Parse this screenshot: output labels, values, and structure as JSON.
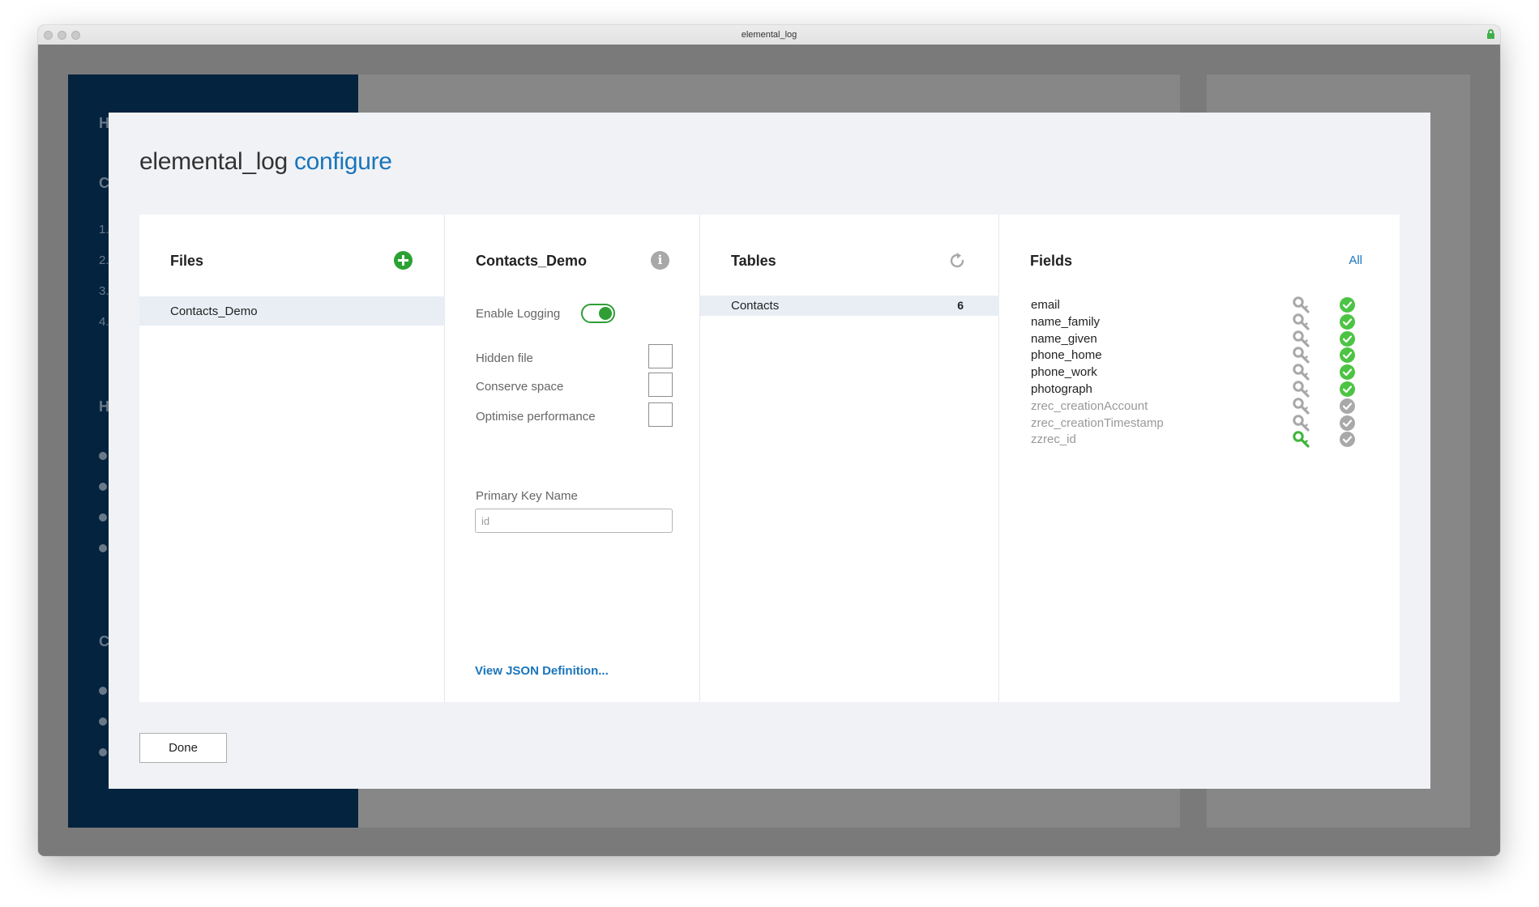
{
  "window": {
    "title": "elemental_log"
  },
  "background": {
    "sidebar_letters": [
      "H",
      "C",
      "H",
      "C"
    ],
    "sidebar_numbers": [
      "1.",
      "2.",
      "3.",
      "4."
    ]
  },
  "modal": {
    "title_app": "elemental_log",
    "title_action": "configure",
    "done_label": "Done"
  },
  "files": {
    "heading": "Files",
    "add_icon": "plus-circle-icon",
    "items": [
      "Contacts_Demo"
    ]
  },
  "file_settings": {
    "heading": "Contacts_Demo",
    "info_icon": "info-icon",
    "enable_logging_label": "Enable Logging",
    "enable_logging": true,
    "hidden_file_label": "Hidden file",
    "conserve_space_label": "Conserve space",
    "optimise_label": "Optimise performance",
    "primary_key_label": "Primary Key Name",
    "primary_key_value": "id",
    "json_link": "View JSON Definition..."
  },
  "tables": {
    "heading": "Tables",
    "refresh_icon": "refresh-icon",
    "items": [
      {
        "name": "Contacts",
        "count": "6"
      }
    ]
  },
  "fields": {
    "heading": "Fields",
    "all_link": "All",
    "items": [
      {
        "name": "email",
        "system": false,
        "primary_key": false
      },
      {
        "name": "name_family",
        "system": false,
        "primary_key": false
      },
      {
        "name": "name_given",
        "system": false,
        "primary_key": false
      },
      {
        "name": "phone_home",
        "system": false,
        "primary_key": false
      },
      {
        "name": "phone_work",
        "system": false,
        "primary_key": false
      },
      {
        "name": "photograph",
        "system": false,
        "primary_key": false
      },
      {
        "name": "zrec_creationAccount",
        "system": true,
        "primary_key": false
      },
      {
        "name": "zrec_creationTimestamp",
        "system": true,
        "primary_key": false
      },
      {
        "name": "zzrec_id",
        "system": true,
        "primary_key": true
      }
    ]
  },
  "colors": {
    "accent": "#1a75bb",
    "active_green": "#4cc443",
    "key_green": "#3db53a",
    "inactive_grey": "#a9a9a9",
    "sidebar_navy": "#04233f"
  }
}
